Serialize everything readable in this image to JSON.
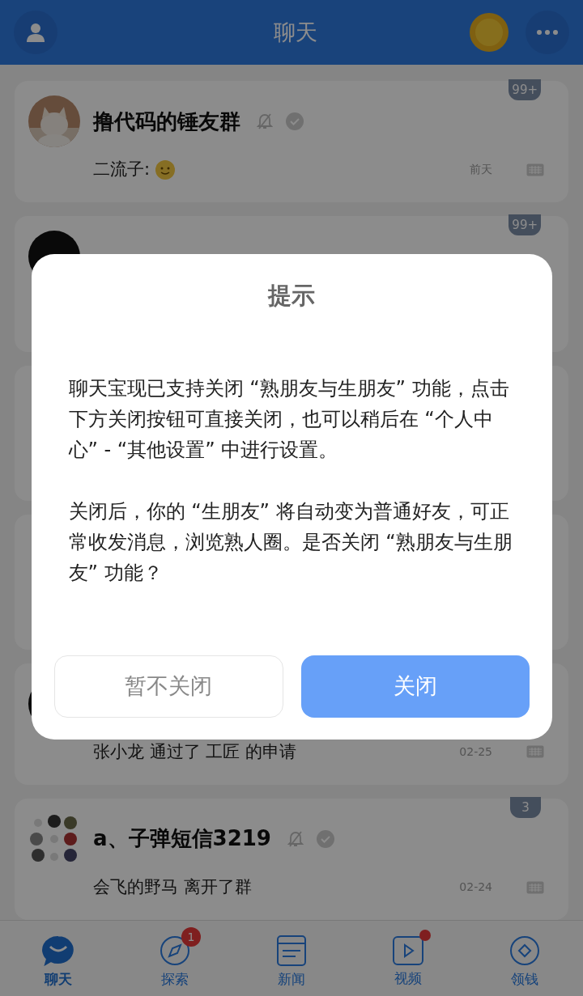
{
  "header": {
    "title": "聊天"
  },
  "chats": [
    {
      "kind": "full",
      "title": "撸代码的锤友群",
      "muted": true,
      "preview": "二流子:",
      "emoji": true,
      "time": "前天",
      "badge": "99+"
    },
    {
      "kind": "covered",
      "badge": "99+"
    },
    {
      "kind": "covered"
    },
    {
      "kind": "covered"
    },
    {
      "kind": "full",
      "preview": "张小龙 通过了 工匠 的申请",
      "time": "02-25"
    },
    {
      "kind": "full",
      "title": "a、子弹短信3219",
      "muted": true,
      "preview": "会飞的野马 离开了群",
      "time": "02-24",
      "badge": "3"
    }
  ],
  "nav": [
    {
      "label": "聊天",
      "selected": true
    },
    {
      "label": "探索",
      "selected": false,
      "badge": "1"
    },
    {
      "label": "新闻",
      "selected": false
    },
    {
      "label": "视频",
      "selected": false,
      "dot": true
    },
    {
      "label": "领钱",
      "selected": false
    }
  ],
  "dialog": {
    "title": "提示",
    "paragraphs": [
      "聊天宝现已支持关闭 “熟朋友与生朋友” 功能，点击下方关闭按钮可直接关闭，也可以稍后在 “个人中心” - “其他设置” 中进行设置。",
      "关闭后，你的 “生朋友” 将自动变为普通好友，可正常收发消息，浏览熟人圈。是否关闭 “熟朋友与生朋友” 功能？"
    ],
    "buttons": [
      {
        "label": "暂不关闭",
        "kind": "secondary"
      },
      {
        "label": "关闭",
        "kind": "primary"
      }
    ]
  }
}
